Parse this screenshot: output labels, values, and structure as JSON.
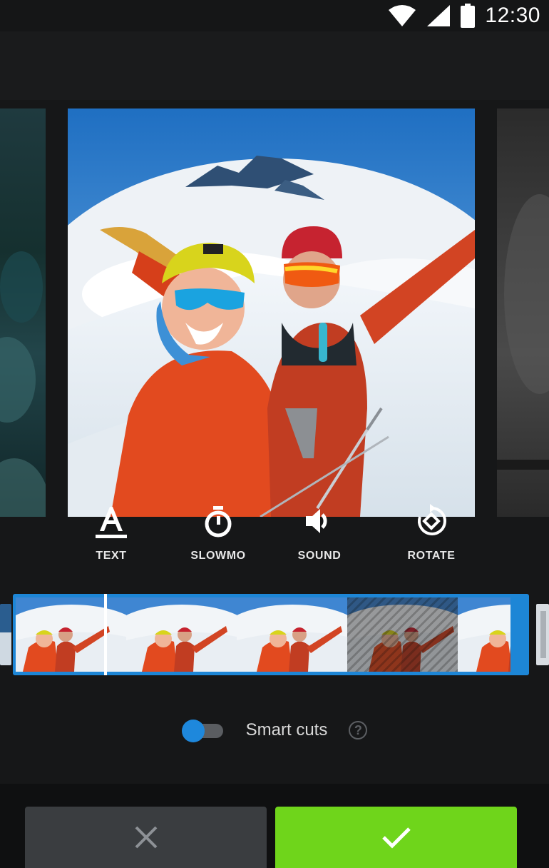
{
  "status_bar": {
    "time": "12:30",
    "icons": [
      "wifi-icon",
      "cellular-signal-icon",
      "battery-icon"
    ]
  },
  "tools": [
    {
      "id": "text",
      "label": "TEXT",
      "icon": "text-format-icon"
    },
    {
      "id": "slowmo",
      "label": "SLOWMO",
      "icon": "stopwatch-icon"
    },
    {
      "id": "sound",
      "label": "SOUND",
      "icon": "speaker-icon"
    },
    {
      "id": "rotate",
      "label": "ROTATE",
      "icon": "rotate-icon"
    }
  ],
  "smart_cuts": {
    "label": "Smart cuts",
    "enabled": true,
    "help_glyph": "?"
  },
  "actions": {
    "cancel_icon": "close-icon",
    "confirm_icon": "check-icon"
  },
  "colors": {
    "accent_blue": "#1e88dc",
    "confirm_green": "#6fd51b",
    "background": "#161718"
  }
}
